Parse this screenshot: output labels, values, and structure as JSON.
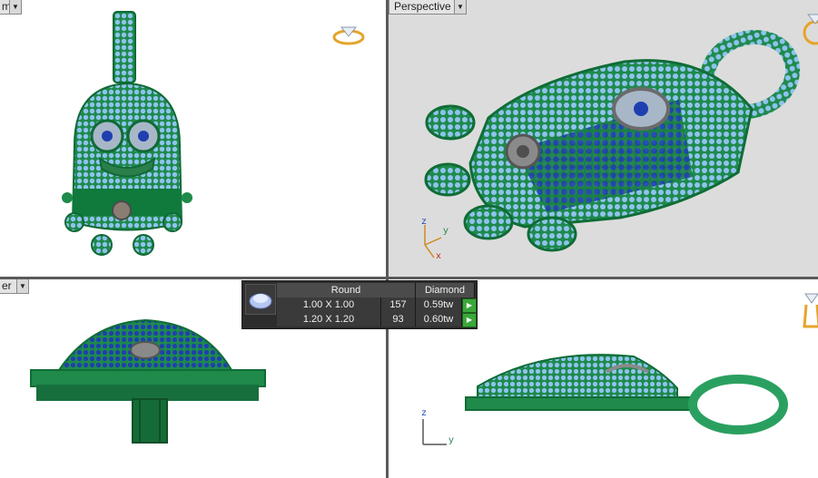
{
  "viewports": {
    "top": {
      "label": "m"
    },
    "perspective": {
      "label": "Perspective",
      "axes": {
        "x": "x",
        "y": "y",
        "z": "z"
      }
    },
    "front": {
      "label": "er"
    },
    "right": {
      "axes": {
        "y": "y",
        "z": "z"
      }
    }
  },
  "gem_panel": {
    "headers": {
      "shape": "Round",
      "type": "Diamond"
    },
    "rows": [
      {
        "size": "1.00 X 1.00",
        "count": "157",
        "weight": "0.59tw"
      },
      {
        "size": "1.20 X 1.20",
        "count": "93",
        "weight": "0.60tw"
      }
    ]
  },
  "icons": {
    "ring": "diamond-ring-icon",
    "gem": "round-gem-thumbnail-icon"
  },
  "colors": {
    "metal_green": "#1f8a4a",
    "stone_light": "#8fc3ee",
    "stone_dark": "#1f3fb0",
    "background_white": "#ffffff",
    "background_grey": "#dcdcdc",
    "ring_gold": "#e5a42a"
  }
}
